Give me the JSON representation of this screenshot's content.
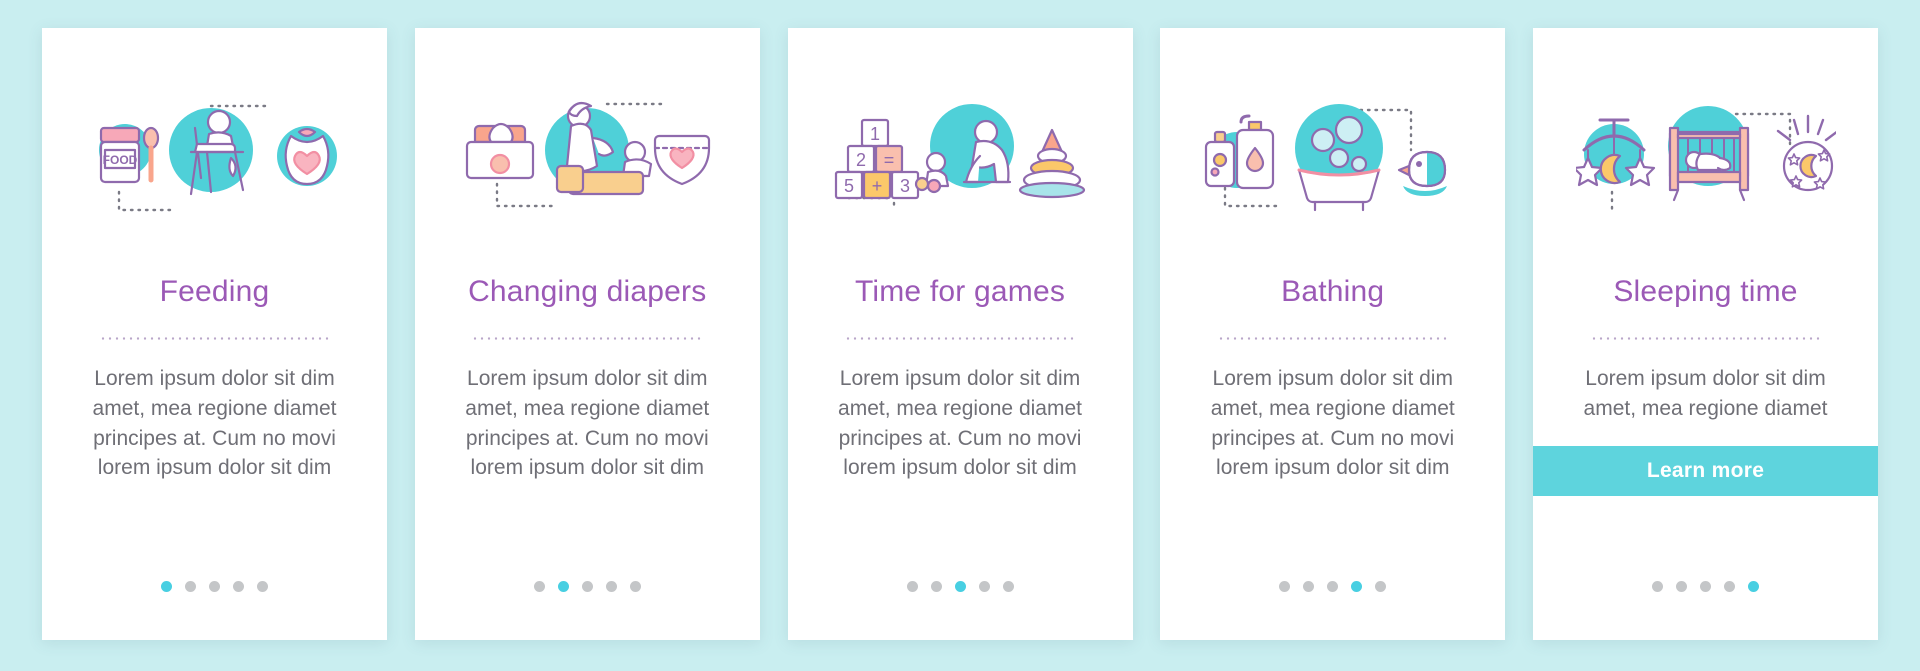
{
  "theme": {
    "background": "#c9eef0",
    "card_background": "#ffffff",
    "title_color": "#9b59b6",
    "body_color": "#6f6f76",
    "accent_teal": "#5ed4dd",
    "dot_active": "#48cfe2",
    "dot_inactive": "#c4c6c8",
    "outline_purple": "#8f6aad",
    "pink": "#f7a8b8",
    "peach": "#f9a58c",
    "yellow": "#fbc86a",
    "circle_teal": "#4fd0d8"
  },
  "cards": [
    {
      "title": "Feeding",
      "body": "Lorem ipsum dolor sit dim amet, mea regione diamet principes at. Cum no movi lorem ipsum dolor sit dim",
      "icons": [
        "food-jar-icon",
        "high-chair-icon",
        "bib-icon"
      ],
      "dots": {
        "count": 5,
        "active_index": 0
      },
      "cta": null
    },
    {
      "title": "Changing diapers",
      "body": "Lorem ipsum dolor sit dim amet, mea regione diamet principes at. Cum no movi lorem ipsum dolor sit dim",
      "icons": [
        "wet-wipes-icon",
        "changing-table-icon",
        "diaper-icon"
      ],
      "dots": {
        "count": 5,
        "active_index": 1
      },
      "cta": null
    },
    {
      "title": "Time for games",
      "body": "Lorem ipsum dolor sit dim amet, mea regione diamet principes at. Cum no movi lorem ipsum dolor sit dim",
      "icons": [
        "number-blocks-icon",
        "playing-baby-icon",
        "stacking-rings-icon"
      ],
      "dots": {
        "count": 5,
        "active_index": 2
      },
      "cta": null
    },
    {
      "title": "Bathing",
      "body": "Lorem ipsum dolor sit dim amet, mea regione diamet principes at. Cum no movi lorem ipsum dolor sit dim",
      "icons": [
        "shampoo-bottles-icon",
        "bathtub-icon",
        "rubber-duck-icon"
      ],
      "dots": {
        "count": 5,
        "active_index": 3
      },
      "cta": null
    },
    {
      "title": "Sleeping time",
      "body": "Lorem ipsum dolor sit dim amet, mea regione diamet",
      "icons": [
        "crib-mobile-icon",
        "crib-icon",
        "night-light-icon"
      ],
      "dots": {
        "count": 5,
        "active_index": 4
      },
      "cta": "Learn more"
    }
  ]
}
